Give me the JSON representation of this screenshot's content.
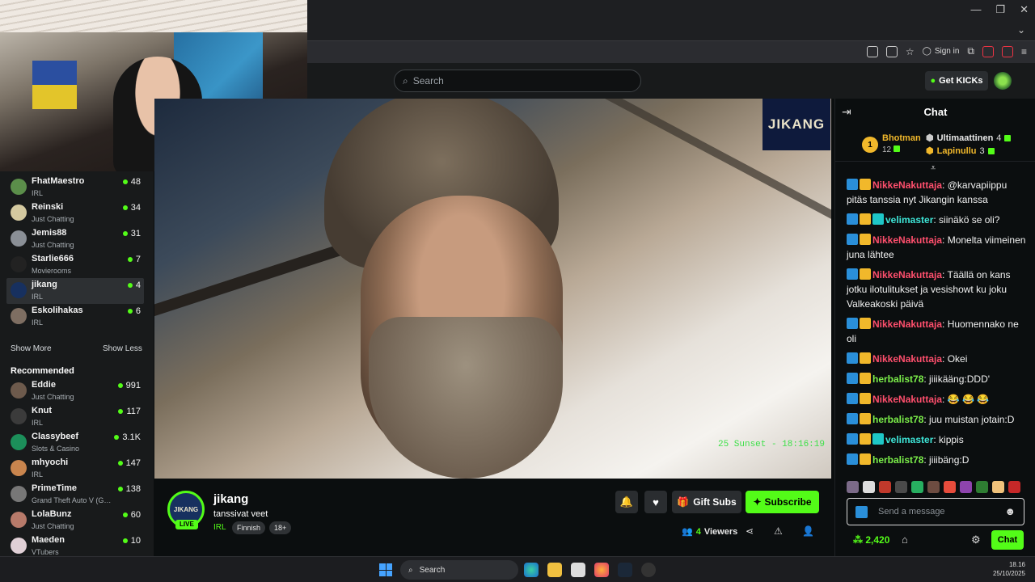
{
  "browser": {
    "sign_in_label": "Sign in"
  },
  "header": {
    "search_placeholder": "Search",
    "get_kicks_label": "Get KICKs"
  },
  "sidebar": {
    "following": [
      {
        "name": "FhatMaestro",
        "category": "IRL",
        "viewers": "48",
        "avatar_color": "#5b8e4a"
      },
      {
        "name": "Reinski",
        "category": "Just Chatting",
        "viewers": "34",
        "avatar_color": "#d4c9a0"
      },
      {
        "name": "Jemis88",
        "category": "Just Chatting",
        "viewers": "31",
        "avatar_color": "#8a8f96"
      },
      {
        "name": "Starlie666",
        "category": "Movierooms",
        "viewers": "7",
        "avatar_color": "#222222"
      },
      {
        "name": "jikang",
        "category": "IRL",
        "viewers": "4",
        "avatar_color": "#17305f"
      },
      {
        "name": "Eskolihakas",
        "category": "IRL",
        "viewers": "6",
        "avatar_color": "#7e6e62"
      }
    ],
    "show_more_label": "Show More",
    "show_less_label": "Show Less",
    "recommended_heading": "Recommended",
    "recommended": [
      {
        "name": "Eddie",
        "category": "Just Chatting",
        "viewers": "991",
        "avatar_color": "#6d5a4c"
      },
      {
        "name": "Knut",
        "category": "IRL",
        "viewers": "117",
        "avatar_color": "#3b3b3b"
      },
      {
        "name": "Classybeef",
        "category": "Slots & Casino",
        "viewers": "3.1K",
        "avatar_color": "#1c8f5a"
      },
      {
        "name": "mhyochi",
        "category": "IRL",
        "viewers": "147",
        "avatar_color": "#c9854e"
      },
      {
        "name": "PrimeTime",
        "category": "Grand Theft Auto V (G…",
        "viewers": "138",
        "avatar_color": "#777777"
      },
      {
        "name": "LolaBunz",
        "category": "Just Chatting",
        "viewers": "60",
        "avatar_color": "#b77a6a"
      },
      {
        "name": "Maeden",
        "category": "VTubers",
        "viewers": "10",
        "avatar_color": "#e0d0d6"
      }
    ]
  },
  "video": {
    "logo_text": "JIKANG",
    "timestamp_overlay": "25 Sunset - 18:16:19"
  },
  "stream": {
    "channel": "jikang",
    "title": "tanssivat veet",
    "category": "IRL",
    "tags": [
      "Finnish",
      "18+"
    ],
    "live_label": "LIVE",
    "avatar_text": "JIKANG",
    "gift_subs_label": "Gift Subs",
    "subscribe_label": "Subscribe",
    "viewer_count": "4",
    "viewers_label": "Viewers"
  },
  "chat": {
    "title": "Chat",
    "leaderboard": {
      "top": {
        "name": "Bhotman",
        "count": "12"
      },
      "others": [
        {
          "name": "Ultimaattinen",
          "count": "4",
          "color": "#e8e8e8"
        },
        {
          "name": "Lapinullu",
          "count": "3",
          "color": "#f1b82b"
        }
      ]
    },
    "messages": [
      {
        "user": "NikkeNakuttaja",
        "color": "#ff4f6d",
        "badges": [
          "b1",
          "b2"
        ],
        "text": ": @karvapiippu pitäs tanssia nyt Jikangin kanssa"
      },
      {
        "user": "velimaster",
        "color": "#3ee6d8",
        "badges": [
          "b1",
          "b2",
          "b3"
        ],
        "text": ": siinäkö se oli?"
      },
      {
        "user": "NikkeNakuttaja",
        "color": "#ff4f6d",
        "badges": [
          "b1",
          "b2"
        ],
        "text": ": Monelta viimeinen juna lähtee"
      },
      {
        "user": "NikkeNakuttaja",
        "color": "#ff4f6d",
        "badges": [
          "b1",
          "b2"
        ],
        "text": ": Täällä on kans jotku ilotulitukset ja vesishowt ku joku Valkeakoski päivä"
      },
      {
        "user": "NikkeNakuttaja",
        "color": "#ff4f6d",
        "badges": [
          "b1",
          "b2"
        ],
        "text": ": Huomennako ne oli"
      },
      {
        "user": "NikkeNakuttaja",
        "color": "#ff4f6d",
        "badges": [
          "b1",
          "b2"
        ],
        "text": ": Okei"
      },
      {
        "user": "herbalist78",
        "color": "#7cf04a",
        "badges": [
          "b1",
          "b2"
        ],
        "text": ": jiiikääng:DDD'"
      },
      {
        "user": "NikkeNakuttaja",
        "color": "#ff4f6d",
        "badges": [
          "b1",
          "b2"
        ],
        "text": ": 😂 😂 😂"
      },
      {
        "user": "herbalist78",
        "color": "#7cf04a",
        "badges": [
          "b1",
          "b2"
        ],
        "text": ": juu muistan jotain:D"
      },
      {
        "user": "velimaster",
        "color": "#3ee6d8",
        "badges": [
          "b1",
          "b2",
          "b3"
        ],
        "text": ": kippis"
      },
      {
        "user": "herbalist78",
        "color": "#7cf04a",
        "badges": [
          "b1",
          "b2"
        ],
        "text": ": jiiibäng:D"
      }
    ],
    "emote_colors": [
      "#7b6a88",
      "#dcdcdc",
      "#c0392b",
      "#4a4a4a",
      "#27ae60",
      "#6d4c41",
      "#e74c3c",
      "#8e44ad",
      "#2e7d32",
      "#f0c27b",
      "#c62828"
    ],
    "input_placeholder": "Send a message",
    "points": "2,420",
    "send_label": "Chat"
  },
  "taskbar": {
    "search_placeholder": "Search",
    "time": "18.16",
    "date": "25/10/2025"
  }
}
